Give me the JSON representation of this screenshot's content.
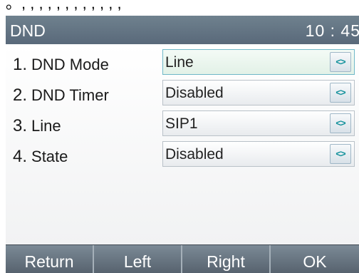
{
  "top_strip_text": "。, , , , , , , , , , , ,",
  "title_bar": {
    "title": "DND",
    "clock": "10 : 45"
  },
  "rows": [
    {
      "number": "1.",
      "label": "DND Mode",
      "value": "Line",
      "switch_icon": "<>"
    },
    {
      "number": "2.",
      "label": "DND Timer",
      "value": "Disabled",
      "switch_icon": "<>"
    },
    {
      "number": "3.",
      "label": "Line",
      "value": "SIP1",
      "switch_icon": "<>"
    },
    {
      "number": "4.",
      "label": "State",
      "value": "Disabled",
      "switch_icon": "<>"
    }
  ],
  "softkeys": [
    "Return",
    "Left",
    "Right",
    "OK"
  ],
  "colors": {
    "title_bar": "#617282",
    "softkey_bar": "#66727e",
    "selected_field_border": "#6fb8c8",
    "switch_arrow": "#10909a"
  }
}
